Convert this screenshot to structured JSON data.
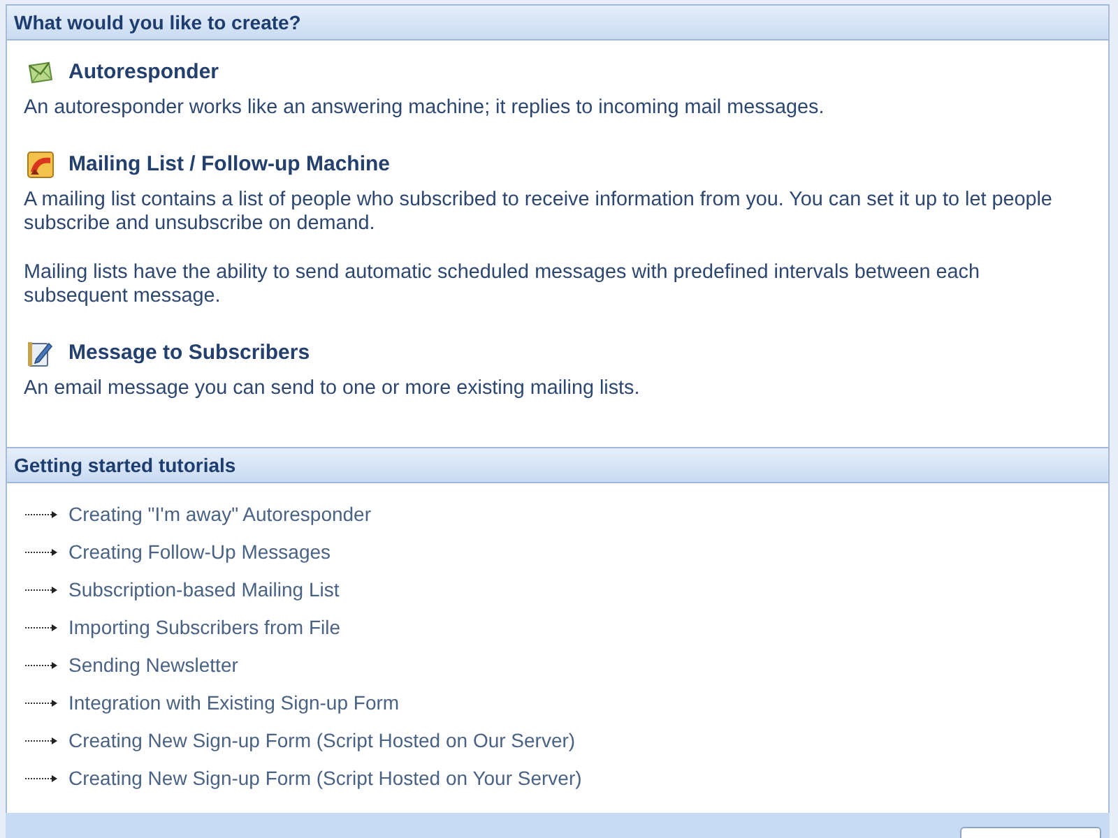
{
  "create_panel": {
    "title": "What would you like to create?",
    "options": [
      {
        "kind": "autoresponder",
        "title": "Autoresponder",
        "paragraphs": [
          "An autoresponder works like an answering machine; it replies to incoming mail messages."
        ]
      },
      {
        "kind": "mailing_list",
        "title": "Mailing List / Follow-up Machine",
        "paragraphs": [
          "A mailing list contains a list of people who subscribed to receive information from you. You can set it up to let people subscribe and unsubscribe on demand.",
          "Mailing lists have the ability to send automatic scheduled messages with predefined intervals between each subsequent message."
        ]
      },
      {
        "kind": "message",
        "title": "Message to Subscribers",
        "paragraphs": [
          "An email message you can send to one or more existing mailing lists."
        ]
      }
    ]
  },
  "tutorials_panel": {
    "title": "Getting started tutorials",
    "links": [
      "Creating \"I'm away\" Autoresponder",
      "Creating Follow-Up Messages",
      "Subscription-based Mailing List",
      "Importing Subscribers from File",
      "Sending Newsletter",
      "Integration with Existing Sign-up Form",
      "Creating New Sign-up Form (Script Hosted on Our Server)",
      "Creating New Sign-up Form (Script Hosted on Your Server)"
    ]
  }
}
